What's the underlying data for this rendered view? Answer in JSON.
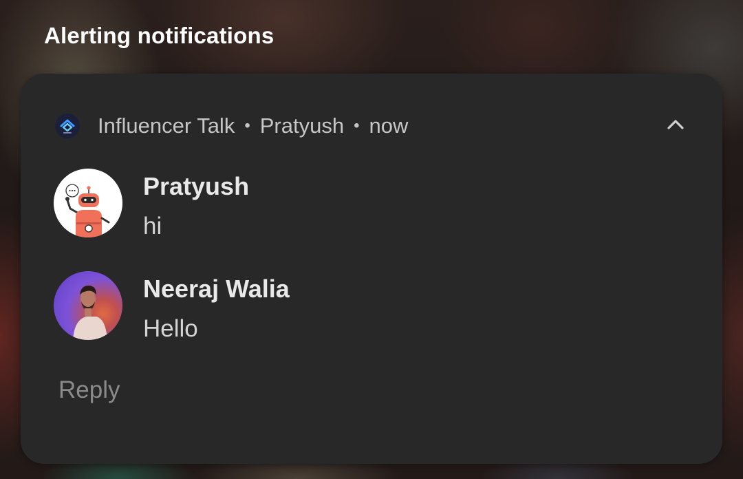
{
  "section_title": "Alerting notifications",
  "notification": {
    "app_icon": "app-logo-icon",
    "app_name": "Influencer Talk",
    "conversation": "Pratyush",
    "time": "now",
    "separator": "•",
    "collapse_icon": "chevron-up-icon",
    "messages": [
      {
        "sender": "Pratyush",
        "text": "hi",
        "avatar": "robot-avatar"
      },
      {
        "sender": "Neeraj Walia",
        "text": "Hello",
        "avatar": "person-avatar"
      }
    ],
    "reply_label": "Reply"
  },
  "colors": {
    "card_background": "#282828",
    "title_text": "#ffffff",
    "header_text": "#c6c6c6",
    "sender_text": "#e9e9e9",
    "message_text": "#d4d4d4",
    "reply_text": "#8a8a8a"
  }
}
